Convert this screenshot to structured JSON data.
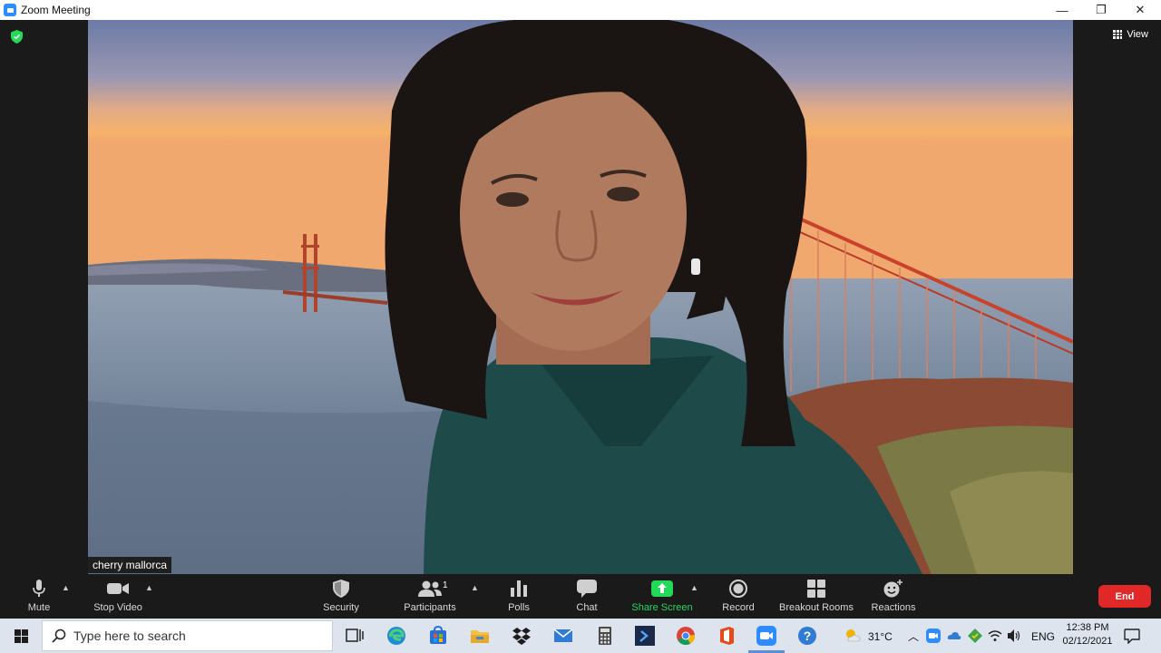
{
  "window": {
    "title": "Zoom Meeting",
    "minimize_glyph": "—",
    "restore_glyph": "❐",
    "close_glyph": "✕"
  },
  "meeting": {
    "view_label": "View",
    "participant_name": "cherry mallorca",
    "shield_color": "#23d959"
  },
  "toolbar": {
    "mute": "Mute",
    "stop_video": "Stop Video",
    "security": "Security",
    "participants": "Participants",
    "participants_count": "1",
    "polls": "Polls",
    "chat": "Chat",
    "share_screen": "Share Screen",
    "record": "Record",
    "breakout_rooms": "Breakout Rooms",
    "reactions": "Reactions",
    "end": "End",
    "end_color": "#e02828",
    "share_color": "#23d959"
  },
  "taskbar": {
    "search_placeholder": "Type here to search",
    "weather": "31°C",
    "language": "ENG",
    "time": "12:38 PM",
    "date": "02/12/2021"
  }
}
